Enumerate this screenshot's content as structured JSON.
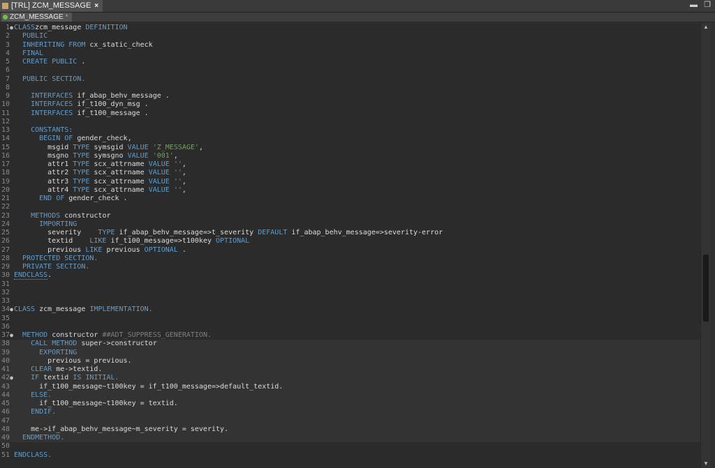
{
  "tab": {
    "title": "[TRL] ZCM_MESSAGE",
    "close": "×"
  },
  "window_controls": {
    "minimize": "▬",
    "maximize": "❐"
  },
  "subtab": {
    "title": "ZCM_MESSAGE",
    "dirty_marker": "*"
  },
  "scrollbar": {
    "up": "▲",
    "down": "▼"
  },
  "code_lines": [
    {
      "n": "1",
      "fold": "●",
      "tokens": [
        [
          "kw",
          "CLASS"
        ],
        [
          "",
          "zcm_message "
        ],
        [
          "kw",
          "DEFINITION"
        ]
      ]
    },
    {
      "n": "2",
      "tokens": [
        [
          "",
          "  "
        ],
        [
          "kw",
          "PUBLIC"
        ]
      ]
    },
    {
      "n": "3",
      "tokens": [
        [
          "",
          "  "
        ],
        [
          "kw",
          "INHERITING FROM"
        ],
        [
          "",
          " cx_static_check"
        ]
      ]
    },
    {
      "n": "4",
      "tokens": [
        [
          "",
          "  "
        ],
        [
          "kw",
          "FINAL"
        ]
      ]
    },
    {
      "n": "5",
      "tokens": [
        [
          "",
          "  "
        ],
        [
          "kw",
          "CREATE PUBLIC"
        ],
        [
          "",
          " ."
        ]
      ]
    },
    {
      "n": "6",
      "tokens": []
    },
    {
      "n": "7",
      "tokens": [
        [
          "",
          "  "
        ],
        [
          "kw",
          "PUBLIC SECTION."
        ]
      ]
    },
    {
      "n": "8",
      "tokens": []
    },
    {
      "n": "9",
      "tokens": [
        [
          "",
          "    "
        ],
        [
          "kw",
          "INTERFACES"
        ],
        [
          "",
          " if_abap_behv_message ."
        ]
      ]
    },
    {
      "n": "10",
      "tokens": [
        [
          "",
          "    "
        ],
        [
          "kw",
          "INTERFACES"
        ],
        [
          "",
          " if_t100_dyn_msg ."
        ]
      ]
    },
    {
      "n": "11",
      "tokens": [
        [
          "",
          "    "
        ],
        [
          "kw",
          "INTERFACES"
        ],
        [
          "",
          " if_t100_message ."
        ]
      ]
    },
    {
      "n": "12",
      "tokens": []
    },
    {
      "n": "13",
      "tokens": [
        [
          "",
          "    "
        ],
        [
          "kw",
          "CONSTANTS:"
        ]
      ]
    },
    {
      "n": "14",
      "tokens": [
        [
          "",
          "      "
        ],
        [
          "kw",
          "BEGIN OF"
        ],
        [
          "",
          " gender_check,"
        ]
      ]
    },
    {
      "n": "15",
      "tokens": [
        [
          "",
          "        msgid "
        ],
        [
          "kw",
          "TYPE"
        ],
        [
          "",
          " symsgid "
        ],
        [
          "kw",
          "VALUE"
        ],
        [
          "",
          " "
        ],
        [
          "str",
          "'Z_MESSAGE'"
        ],
        [
          "",
          ","
        ]
      ]
    },
    {
      "n": "16",
      "tokens": [
        [
          "",
          "        msgno "
        ],
        [
          "kw",
          "TYPE"
        ],
        [
          "",
          " symsgno "
        ],
        [
          "kw",
          "VALUE"
        ],
        [
          "",
          " "
        ],
        [
          "str",
          "'001'"
        ],
        [
          "",
          ","
        ]
      ]
    },
    {
      "n": "17",
      "tokens": [
        [
          "",
          "        attr1 "
        ],
        [
          "kw",
          "TYPE"
        ],
        [
          "",
          " scx_attrname "
        ],
        [
          "kw",
          "VALUE"
        ],
        [
          "",
          " "
        ],
        [
          "str",
          "''"
        ],
        [
          "",
          ","
        ]
      ]
    },
    {
      "n": "18",
      "tokens": [
        [
          "",
          "        attr2 "
        ],
        [
          "kw",
          "TYPE"
        ],
        [
          "",
          " scx_attrname "
        ],
        [
          "kw",
          "VALUE"
        ],
        [
          "",
          " "
        ],
        [
          "str",
          "''"
        ],
        [
          "",
          ","
        ]
      ]
    },
    {
      "n": "19",
      "tokens": [
        [
          "",
          "        attr3 "
        ],
        [
          "kw",
          "TYPE"
        ],
        [
          "",
          " scx_attrname "
        ],
        [
          "kw",
          "VALUE"
        ],
        [
          "",
          " "
        ],
        [
          "str",
          "''"
        ],
        [
          "",
          ","
        ]
      ]
    },
    {
      "n": "20",
      "tokens": [
        [
          "",
          "        attr4 "
        ],
        [
          "kw",
          "TYPE"
        ],
        [
          "",
          " scx_attrname "
        ],
        [
          "kw",
          "VALUE"
        ],
        [
          "",
          " "
        ],
        [
          "str",
          "''"
        ],
        [
          "",
          ","
        ]
      ]
    },
    {
      "n": "21",
      "tokens": [
        [
          "",
          "      "
        ],
        [
          "kw",
          "END OF"
        ],
        [
          "",
          " gender_check ."
        ]
      ]
    },
    {
      "n": "22",
      "tokens": []
    },
    {
      "n": "23",
      "tokens": [
        [
          "",
          "    "
        ],
        [
          "kw",
          "METHODS"
        ],
        [
          "",
          " constructor"
        ]
      ]
    },
    {
      "n": "24",
      "tokens": [
        [
          "",
          "      "
        ],
        [
          "kw",
          "IMPORTING"
        ]
      ]
    },
    {
      "n": "25",
      "tokens": [
        [
          "",
          "        severity    "
        ],
        [
          "kw",
          "TYPE"
        ],
        [
          "",
          " if_abap_behv_message=>t_severity "
        ],
        [
          "kw",
          "DEFAULT"
        ],
        [
          "",
          " if_abap_behv_message=>severity-error"
        ]
      ]
    },
    {
      "n": "26",
      "tokens": [
        [
          "",
          "        textid    "
        ],
        [
          "kw",
          "LIKE"
        ],
        [
          "",
          " if_t100_message=>t100key "
        ],
        [
          "kw",
          "OPTIONAL"
        ]
      ]
    },
    {
      "n": "27",
      "tokens": [
        [
          "",
          "        previous "
        ],
        [
          "kw",
          "LIKE"
        ],
        [
          "",
          " previous "
        ],
        [
          "kw",
          "OPTIONAL"
        ],
        [
          "",
          " ."
        ]
      ]
    },
    {
      "n": "28",
      "tokens": [
        [
          "",
          "  "
        ],
        [
          "kw",
          "PROTECTED SECTION."
        ]
      ]
    },
    {
      "n": "29",
      "tokens": [
        [
          "",
          "  "
        ],
        [
          "kw",
          "PRIVATE SECTION."
        ]
      ]
    },
    {
      "n": "30",
      "tokens": [
        [
          "kwu",
          "ENDCLASS"
        ],
        [
          "",
          "."
        ]
      ]
    },
    {
      "n": "31",
      "tokens": []
    },
    {
      "n": "32",
      "tokens": []
    },
    {
      "n": "33",
      "tokens": []
    },
    {
      "n": "34",
      "fold": "●",
      "tokens": [
        [
          "kw",
          "CLASS"
        ],
        [
          "",
          " zcm_message "
        ],
        [
          "kw",
          "IMPLEMENTATION."
        ]
      ]
    },
    {
      "n": "35",
      "tokens": []
    },
    {
      "n": "36",
      "tokens": []
    },
    {
      "n": "37",
      "fold": "●",
      "tokens": [
        [
          "",
          "  "
        ],
        [
          "kw",
          "METHOD"
        ],
        [
          "",
          " constructor "
        ],
        [
          "cmt",
          "##ADT_SUPPRESS_GENERATION."
        ]
      ]
    },
    {
      "n": "38",
      "hl": true,
      "tokens": [
        [
          "",
          "    "
        ],
        [
          "kw",
          "CALL METHOD"
        ],
        [
          "",
          " super->constructor"
        ]
      ]
    },
    {
      "n": "39",
      "hl": true,
      "tokens": [
        [
          "",
          "      "
        ],
        [
          "kw",
          "EXPORTING"
        ]
      ]
    },
    {
      "n": "40",
      "hl": true,
      "tokens": [
        [
          "",
          "        previous = previous."
        ]
      ]
    },
    {
      "n": "41",
      "hl": true,
      "tokens": [
        [
          "",
          "    "
        ],
        [
          "kw",
          "CLEAR"
        ],
        [
          "",
          " me->textid."
        ]
      ]
    },
    {
      "n": "42",
      "fold": "●",
      "hl": true,
      "tokens": [
        [
          "",
          "    "
        ],
        [
          "kw",
          "IF"
        ],
        [
          "",
          " textid "
        ],
        [
          "kw",
          "IS INITIAL."
        ]
      ]
    },
    {
      "n": "43",
      "hl": true,
      "tokens": [
        [
          "",
          "      if_t100_message~t100key = if_t100_message=>default_textid."
        ]
      ]
    },
    {
      "n": "44",
      "hl": true,
      "tokens": [
        [
          "",
          "    "
        ],
        [
          "kw",
          "ELSE."
        ]
      ]
    },
    {
      "n": "45",
      "hl": true,
      "tokens": [
        [
          "",
          "      if_t100_message~t100key = textid."
        ]
      ]
    },
    {
      "n": "46",
      "hl": true,
      "tokens": [
        [
          "",
          "    "
        ],
        [
          "kw",
          "ENDIF."
        ]
      ]
    },
    {
      "n": "47",
      "hl": true,
      "tokens": []
    },
    {
      "n": "48",
      "hl": true,
      "tokens": [
        [
          "",
          "    me->if_abap_behv_message~m_severity = severity."
        ]
      ]
    },
    {
      "n": "49",
      "hl": true,
      "tokens": [
        [
          "",
          "  "
        ],
        [
          "kw",
          "ENDMETHOD."
        ]
      ]
    },
    {
      "n": "50",
      "tokens": []
    },
    {
      "n": "51",
      "tokens": [
        [
          "kw",
          "ENDCLASS."
        ]
      ]
    }
  ]
}
